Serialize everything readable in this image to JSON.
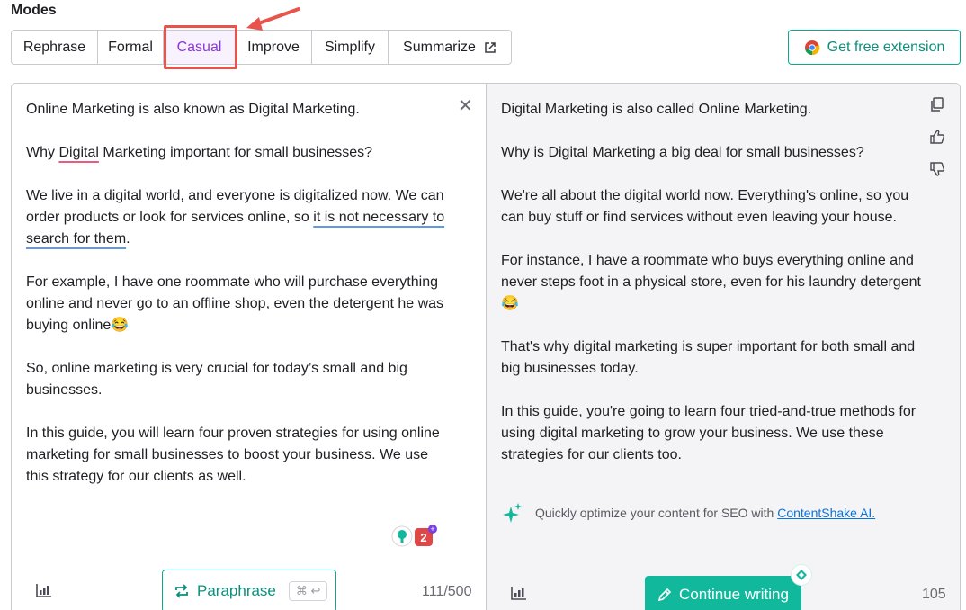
{
  "modes": {
    "title": "Modes",
    "tabs": [
      {
        "label": "Rephrase"
      },
      {
        "label": "Formal"
      },
      {
        "label": "Casual"
      },
      {
        "label": "Improve"
      },
      {
        "label": "Simplify"
      },
      {
        "label": "Summarize"
      }
    ],
    "active_tab": "Casual"
  },
  "extension_button": {
    "label": "Get free extension"
  },
  "input": {
    "paragraphs": {
      "p1": "Online Marketing is also known as Digital Marketing.",
      "p2_a": "Why ",
      "p2_b": "Digital",
      "p2_c": " Marketing important for small businesses?",
      "p3_a": "We live in a digital world, and everyone is digitalized now. We can order products or look for services online, so ",
      "p3_b": "it is not necessary to search for them",
      "p3_c": ".",
      "p4": "For example, I have one roommate who will purchase everything online and never go to an offline shop, even the detergent he was buying online😂",
      "p5": "So, online marketing is very crucial for today’s small and big businesses.",
      "p6": "In this guide, you will learn four proven strategies for using online marketing for small businesses to boost your business. We use this strategy for our clients as well."
    },
    "badge_count": "2",
    "paraphrase_label": "Paraphrase",
    "shortcut": "⌘ ↩",
    "counter": "111/500"
  },
  "output": {
    "paragraphs": {
      "p1": "Digital Marketing is also called Online Marketing.",
      "p2": "Why is Digital Marketing a big deal for small businesses?",
      "p3": "We're all about the digital world now. Everything's online, so you can buy stuff or find services without even leaving your house.",
      "p4": "For instance, I have a roommate who buys everything online and never steps foot in a physical store, even for his laundry detergent😂",
      "p5": "That's why digital marketing is super important for both small and big businesses today.",
      "p6": "In this guide, you're going to learn four tried-and-true methods for using digital marketing to grow your business. We use these strategies for our clients too."
    },
    "seo_text": "Quickly optimize your content for SEO with ",
    "seo_link": "ContentShake AI.",
    "continue_label": "Continue writing",
    "counter": "105"
  },
  "colors": {
    "accent_purple": "#8c37d9",
    "brand_green": "#12b89b",
    "annotation_red": "#e8534b"
  }
}
